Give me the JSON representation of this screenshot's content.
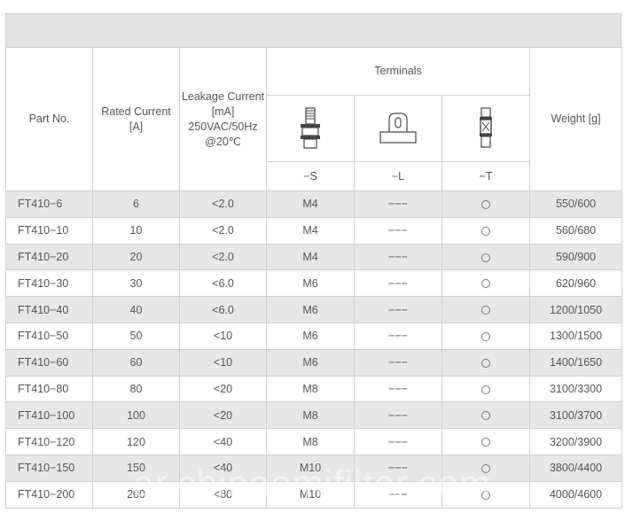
{
  "table": {
    "headers": {
      "part_no": "Part No.",
      "rated_current": "Rated Current [A]",
      "leakage_current": "Leakage Current [mA] 250VAC/50Hz @20℃",
      "terminals": "Terminals",
      "weight": "Weight [g]",
      "suffix_s": "−S",
      "suffix_l": "−L",
      "suffix_t": "−T"
    },
    "rows": [
      {
        "part": "FT410−6",
        "rated": "6",
        "leakage": "<2.0",
        "s": "M4",
        "l": "−−−",
        "t": "circle",
        "weight": "550/600"
      },
      {
        "part": "FT410−10",
        "rated": "10",
        "leakage": "<2.0",
        "s": "M4",
        "l": "−−−",
        "t": "circle",
        "weight": "560/680"
      },
      {
        "part": "FT410−20",
        "rated": "20",
        "leakage": "<2.0",
        "s": "M4",
        "l": "−−−",
        "t": "circle",
        "weight": "590/900"
      },
      {
        "part": "FT410−30",
        "rated": "30",
        "leakage": "<6.0",
        "s": "M6",
        "l": "−−−",
        "t": "circle",
        "weight": "620/960"
      },
      {
        "part": "FT410−40",
        "rated": "40",
        "leakage": "<6.0",
        "s": "M6",
        "l": "−−−",
        "t": "circle",
        "weight": "1200/1050"
      },
      {
        "part": "FT410−50",
        "rated": "50",
        "leakage": "<10",
        "s": "M6",
        "l": "−−−",
        "t": "circle",
        "weight": "1300/1500"
      },
      {
        "part": "FT410−60",
        "rated": "60",
        "leakage": "<10",
        "s": "M6",
        "l": "−−−",
        "t": "circle",
        "weight": "1400/1650"
      },
      {
        "part": "FT410−80",
        "rated": "80",
        "leakage": "<20",
        "s": "M8",
        "l": "−−−",
        "t": "circle",
        "weight": "3100/3300"
      },
      {
        "part": "FT410−100",
        "rated": "100",
        "leakage": "<20",
        "s": "M8",
        "l": "−−−",
        "t": "circle",
        "weight": "3100/3700"
      },
      {
        "part": "FT410−120",
        "rated": "120",
        "leakage": "<40",
        "s": "M8",
        "l": "−−−",
        "t": "circle",
        "weight": "3200/3900"
      },
      {
        "part": "FT410−150",
        "rated": "150",
        "leakage": "<40",
        "s": "M10",
        "l": "−−−",
        "t": "circle",
        "weight": "3800/4400"
      },
      {
        "part": "FT410−200",
        "rated": "200",
        "leakage": "<80",
        "s": "M10",
        "l": "−−−",
        "t": "circle",
        "weight": "4000/4600"
      }
    ]
  },
  "watermark": "ar.chinaemifilter.com",
  "icons": {
    "terminal_s": "screw-terminal-icon",
    "terminal_l": "lug-terminal-icon",
    "terminal_t": "tab-terminal-icon",
    "available": "circle-mark-icon"
  }
}
